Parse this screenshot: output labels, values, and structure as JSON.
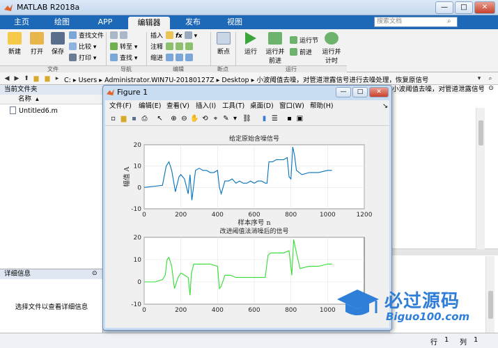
{
  "window": {
    "title": "MATLAB R2018a",
    "buttons": {
      "minimize": "—",
      "maximize": "□",
      "close": "✕"
    }
  },
  "tabs": [
    {
      "label": "主页"
    },
    {
      "label": "绘图"
    },
    {
      "label": "APP"
    },
    {
      "label": "编辑器"
    },
    {
      "label": "发布"
    },
    {
      "label": "视图"
    }
  ],
  "search": {
    "placeholder": "搜索文档"
  },
  "ribbon": {
    "file": {
      "new": "新建",
      "open": "打开",
      "save": "保存",
      "find_files": "查找文件",
      "compare": "比较",
      "print": "打印",
      "group": "文件"
    },
    "navigate": {
      "insert": "插入",
      "goto": "转至",
      "comment": "注释",
      "find": "查找",
      "indent": "缩进",
      "group": "导航"
    },
    "edit": {
      "fx": "fx",
      "group": "编辑"
    },
    "breakpoints": {
      "label": "断点",
      "group": "断点"
    },
    "run": {
      "run": "运行",
      "run_advance": "运行并前进",
      "run_section": "运行节",
      "advance": "前进",
      "run_time": "运行并计时",
      "group": "运行"
    }
  },
  "path": {
    "segments": [
      "C:",
      "Users",
      "Administrator.WIN7U-20180127Z",
      "Desktop",
      "小波阈值去噪，对管道泄露信号进行去噪处理，恢复原信号"
    ]
  },
  "file_panel": {
    "title": "当前文件夹",
    "column": "名称",
    "files": [
      "Untitled6.m"
    ]
  },
  "details_panel": {
    "title": "详细信息",
    "hint": "选择文件以查看详细信息"
  },
  "right_panel": {
    "title": "小波阈值去噪，对管道泄露信号进行去噪处理，恢复原信号"
  },
  "statusbar": {
    "row_label": "行",
    "row": "1",
    "col_label": "列",
    "col": "1"
  },
  "figure": {
    "title": "Figure 1",
    "menus": [
      "文件(F)",
      "编辑(E)",
      "查看(V)",
      "插入(I)",
      "工具(T)",
      "桌面(D)",
      "窗口(W)",
      "帮助(H)"
    ]
  },
  "watermark": {
    "text": "必过源码",
    "url": "Biguo100.com"
  },
  "colors": {
    "accent": "#1e68b8",
    "series1": "#0072bd",
    "series2": "#33dd33"
  },
  "chart_data": [
    {
      "type": "line",
      "title": "给定原始含噪信号",
      "xlabel": "样本序号 n",
      "ylabel": "幅值 A",
      "xlim": [
        0,
        1200
      ],
      "ylim": [
        -10,
        20
      ],
      "xticks": [
        0,
        200,
        400,
        600,
        800,
        1000,
        1200
      ],
      "yticks": [
        -10,
        0,
        10,
        20
      ],
      "grid": true,
      "series": [
        {
          "x": [
            0,
            100,
            120,
            135,
            150,
            170,
            190,
            200,
            220,
            240,
            250,
            260,
            280,
            300,
            320,
            340,
            360,
            380,
            400,
            410,
            420,
            440,
            460,
            480,
            500,
            520,
            540,
            560,
            580,
            600,
            620,
            640,
            660,
            670,
            680,
            700,
            720,
            740,
            760,
            780,
            790,
            800,
            810,
            820,
            830,
            860,
            900,
            950,
            1000,
            1024
          ],
          "y": [
            0,
            1,
            10,
            12,
            8,
            -2,
            5,
            6,
            4,
            -3,
            6,
            -6,
            8,
            9,
            8,
            8,
            7,
            7,
            8,
            0,
            -3,
            3,
            3,
            4,
            2,
            3,
            2,
            2,
            3,
            2,
            3,
            3,
            2,
            2,
            12,
            12,
            13,
            13,
            13,
            14,
            5,
            4,
            19,
            15,
            8,
            6,
            7,
            7,
            8,
            8
          ]
        }
      ]
    },
    {
      "type": "line",
      "title": "改进阈值法消噪后的信号",
      "xlim": [
        0,
        1200
      ],
      "ylim": [
        -10,
        20
      ],
      "xticks": [
        0,
        200,
        400,
        600,
        800,
        1000
      ],
      "yticks": [
        -10,
        0,
        10,
        20
      ],
      "grid": true,
      "series": [
        {
          "x": [
            0,
            60,
            100,
            115,
            125,
            135,
            150,
            165,
            185,
            200,
            220,
            240,
            250,
            258,
            270,
            290,
            320,
            360,
            400,
            410,
            420,
            440,
            470,
            500,
            540,
            580,
            620,
            660,
            675,
            690,
            720,
            760,
            790,
            805,
            815,
            830,
            850,
            900,
            950,
            1000,
            1024
          ],
          "y": [
            0,
            0,
            1,
            3,
            10,
            11,
            7,
            -3,
            2,
            4,
            3,
            2,
            -6,
            4,
            8,
            8,
            8,
            8,
            7,
            -3,
            -2,
            3,
            3,
            2,
            2,
            2,
            2,
            2,
            12,
            13,
            13,
            13,
            14,
            3,
            19,
            13,
            6,
            7,
            7,
            8,
            8
          ]
        }
      ]
    }
  ]
}
